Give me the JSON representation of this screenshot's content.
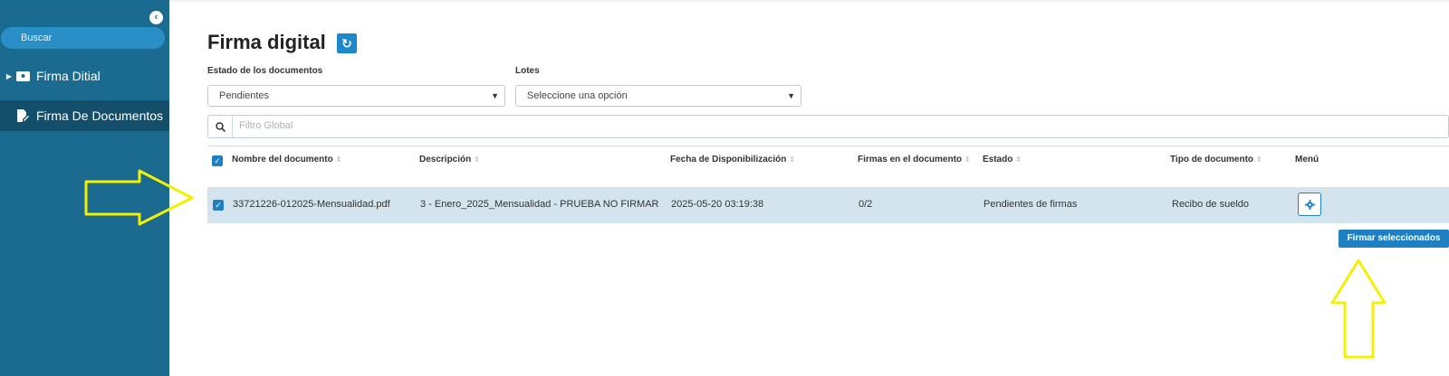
{
  "sidebar": {
    "collapse_icon": "chevron-left-icon",
    "search_label": "Buscar",
    "items": [
      {
        "label": "Firma Ditial",
        "icon": "id-card-icon",
        "expandable": true,
        "active": false
      },
      {
        "label": "Firma De Documentos",
        "icon": "document-edit-icon",
        "expandable": false,
        "active": true
      }
    ]
  },
  "page": {
    "title": "Firma digital",
    "refresh_icon": "refresh-icon"
  },
  "filters": {
    "estado_label": "Estado de los documentos",
    "estado_value": "Pendientes",
    "lotes_label": "Lotes",
    "lotes_value": "Seleccione una opción",
    "global_placeholder": "Filtro Global"
  },
  "table": {
    "columns": [
      "Nombre del documento",
      "Descripción",
      "Fecha de Disponibilización",
      "Firmas en el documento",
      "Estado",
      "Tipo de documento",
      "Menú"
    ],
    "rows": [
      {
        "selected": true,
        "nombre": "33721226-012025-Mensualidad.pdf",
        "descripcion": "3 - Enero_2025_Mensualidad - PRUEBA NO FIRMAR",
        "fecha": "2025-05-20 03:19:38",
        "firmas": "0/2",
        "estado": "Pendientes de firmas",
        "tipo": "Recibo de sueldo"
      }
    ]
  },
  "actions": {
    "sign_selected_label": "Firmar seleccionados"
  },
  "colors": {
    "sidebar": "#1b6a8f",
    "accent": "#1f7fc3",
    "row_highlight": "#d3e4ee",
    "annotation_arrow": "#f5f000"
  }
}
